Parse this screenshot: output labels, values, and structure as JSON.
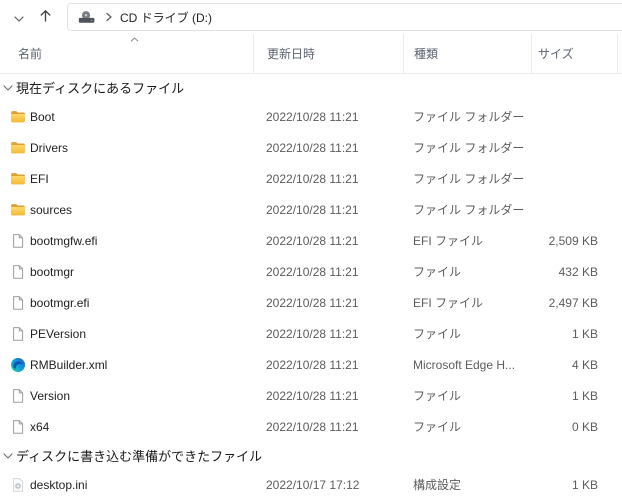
{
  "toolbar": {
    "breadcrumb": {
      "drive_label": "CD ドライブ (D:)"
    }
  },
  "columns": {
    "name": "名前",
    "date": "更新日時",
    "type": "種類",
    "size": "サイズ",
    "sort": {
      "column": "name",
      "direction": "ascending"
    }
  },
  "groups": [
    {
      "label": "現在ディスクにあるファイル",
      "rows": [
        {
          "name": "Boot",
          "icon": "folder",
          "date": "2022/10/28 11:21",
          "type": "ファイル フォルダー",
          "size": ""
        },
        {
          "name": "Drivers",
          "icon": "folder",
          "date": "2022/10/28 11:21",
          "type": "ファイル フォルダー",
          "size": ""
        },
        {
          "name": "EFI",
          "icon": "folder",
          "date": "2022/10/28 11:21",
          "type": "ファイル フォルダー",
          "size": ""
        },
        {
          "name": "sources",
          "icon": "folder",
          "date": "2022/10/28 11:21",
          "type": "ファイル フォルダー",
          "size": ""
        },
        {
          "name": "bootmgfw.efi",
          "icon": "file",
          "date": "2022/10/28 11:21",
          "type": "EFI ファイル",
          "size": "2,509 KB"
        },
        {
          "name": "bootmgr",
          "icon": "file",
          "date": "2022/10/28 11:21",
          "type": "ファイル",
          "size": "432 KB"
        },
        {
          "name": "bootmgr.efi",
          "icon": "file",
          "date": "2022/10/28 11:21",
          "type": "EFI ファイル",
          "size": "2,497 KB"
        },
        {
          "name": "PEVersion",
          "icon": "file",
          "date": "2022/10/28 11:21",
          "type": "ファイル",
          "size": "1 KB"
        },
        {
          "name": "RMBuilder.xml",
          "icon": "edge",
          "date": "2022/10/28 11:21",
          "type": "Microsoft Edge H...",
          "size": "4 KB"
        },
        {
          "name": "Version",
          "icon": "file",
          "date": "2022/10/28 11:21",
          "type": "ファイル",
          "size": "1 KB"
        },
        {
          "name": "x64",
          "icon": "file",
          "date": "2022/10/28 11:21",
          "type": "ファイル",
          "size": "0 KB"
        }
      ]
    },
    {
      "label": "ディスクに書き込む準備ができたファイル",
      "rows": [
        {
          "name": "desktop.ini",
          "icon": "ini",
          "date": "2022/10/17 17:12",
          "type": "構成設定",
          "size": "1 KB"
        }
      ]
    }
  ],
  "icons": {
    "history_dropdown": "chevron-down",
    "navigate_up": "arrow-up",
    "drive": "cd-drive",
    "breadcrumb_separator": "chevron-right",
    "sort_indicator": "chevron-up",
    "group_collapse": "chevron-down",
    "row_icon_types": {
      "folder": "yellow-folder",
      "file": "blank-document",
      "edge": "microsoft-edge-logo",
      "ini": "settings-gear-document"
    }
  },
  "colors": {
    "folder_yellow": "#f3ba37",
    "folder_yellow_light": "#ffd96a",
    "folder_back": "#dfa033",
    "edge_blue": "#2156cf",
    "edge_teal": "#0aa3e0",
    "edge_green": "#38d08c",
    "header_text": "#5d6470",
    "primary_text": "#1f1f1f",
    "secondary_text": "#5c5c5c",
    "border": "#ececec"
  }
}
